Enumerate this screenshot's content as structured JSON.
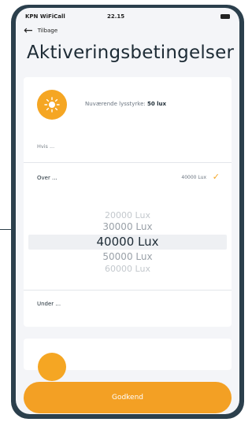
{
  "status_bar": {
    "carrier": "KPN WiFiCall",
    "time": "22.15"
  },
  "nav": {
    "back_label": "Tilbage"
  },
  "page": {
    "title": "Aktiveringsbetingelser"
  },
  "sensor": {
    "icon": "sun-icon",
    "brightness_label": "Nuværende lysstyrke:",
    "brightness_value": "50 lux"
  },
  "conditions": {
    "hvis_label": "Hvis ...",
    "over_label": "Over ...",
    "over_value": "40000 Lux",
    "under_label": "Under ..."
  },
  "picker": {
    "options": [
      "20000 Lux",
      "30000 Lux",
      "40000 Lux",
      "50000 Lux",
      "60000 Lux"
    ],
    "selected_index": 2
  },
  "footer": {
    "ok_label": "Godkend"
  },
  "colors": {
    "accent": "#f3a024",
    "frame": "#2b3f4c",
    "text": "#1d2b35"
  }
}
